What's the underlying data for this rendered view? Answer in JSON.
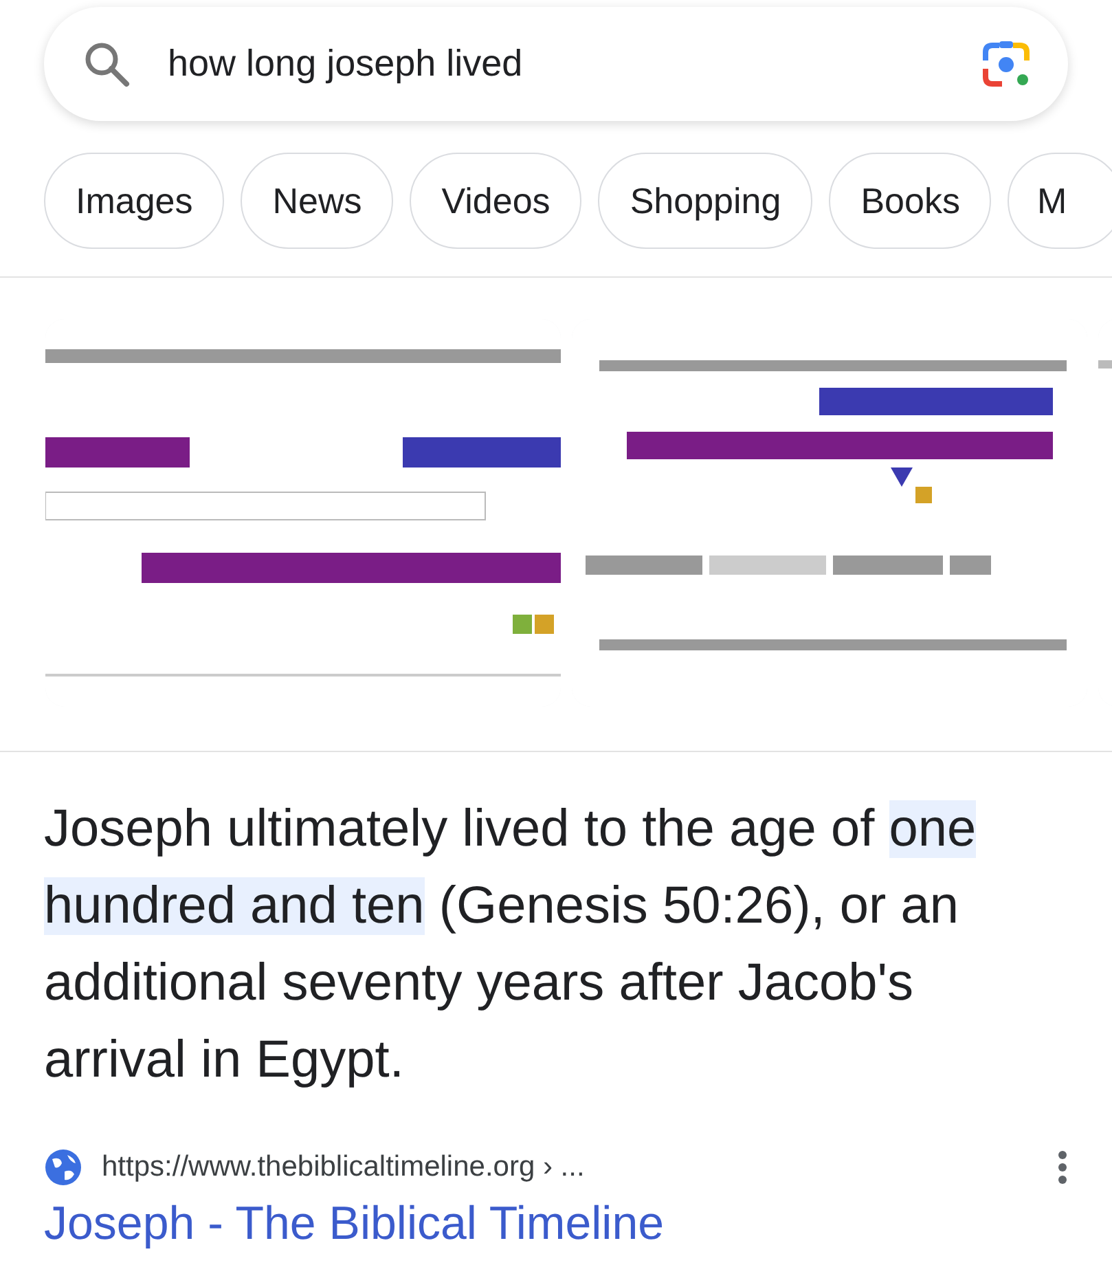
{
  "search": {
    "query": "how long joseph lived"
  },
  "chips": [
    {
      "label": "Images"
    },
    {
      "label": "News"
    },
    {
      "label": "Videos"
    },
    {
      "label": "Shopping"
    },
    {
      "label": "Books"
    },
    {
      "label": "M"
    }
  ],
  "answer": {
    "segments": [
      {
        "text": "Joseph ultimately lived to the age of ",
        "highlight": false
      },
      {
        "text": "one hundred and ten",
        "highlight": true
      },
      {
        "text": " (Genesis 50:26), or an additional seventy years after Jacob's arrival in Egypt.",
        "highlight": false
      }
    ]
  },
  "result": {
    "url": "https://www.thebiblicaltimeline.org › ...",
    "title": "Joseph - The Biblical Timeline"
  }
}
